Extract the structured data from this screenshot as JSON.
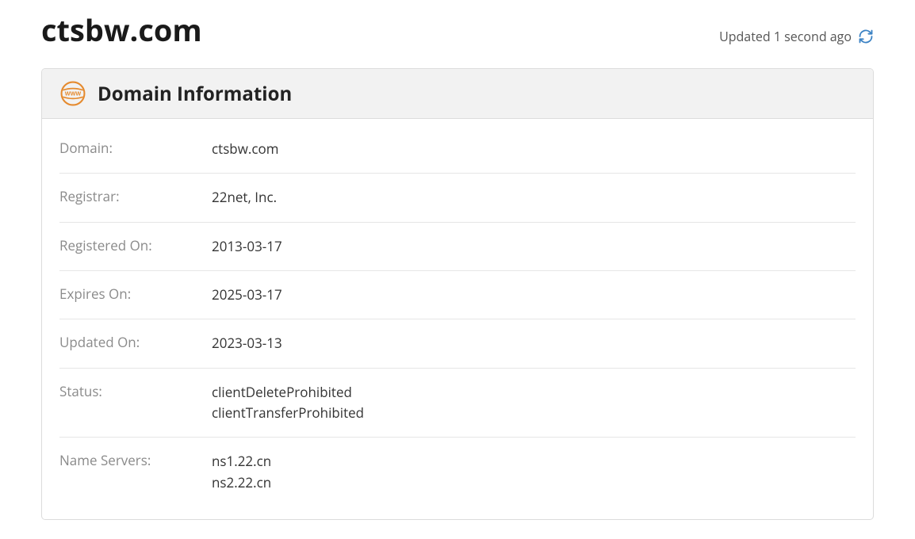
{
  "header": {
    "domain_title": "ctsbw.com",
    "updated_text": "Updated 1 second ago"
  },
  "panel": {
    "title": "Domain Information"
  },
  "info": {
    "domain_label": "Domain:",
    "domain_value": "ctsbw.com",
    "registrar_label": "Registrar:",
    "registrar_value": "22net, Inc.",
    "registered_on_label": "Registered On:",
    "registered_on_value": "2013-03-17",
    "expires_on_label": "Expires On:",
    "expires_on_value": "2025-03-17",
    "updated_on_label": "Updated On:",
    "updated_on_value": "2023-03-13",
    "status_label": "Status:",
    "status_value": "clientDeleteProhibited\nclientTransferProhibited",
    "name_servers_label": "Name Servers:",
    "name_servers_value": "ns1.22.cn\nns2.22.cn"
  }
}
